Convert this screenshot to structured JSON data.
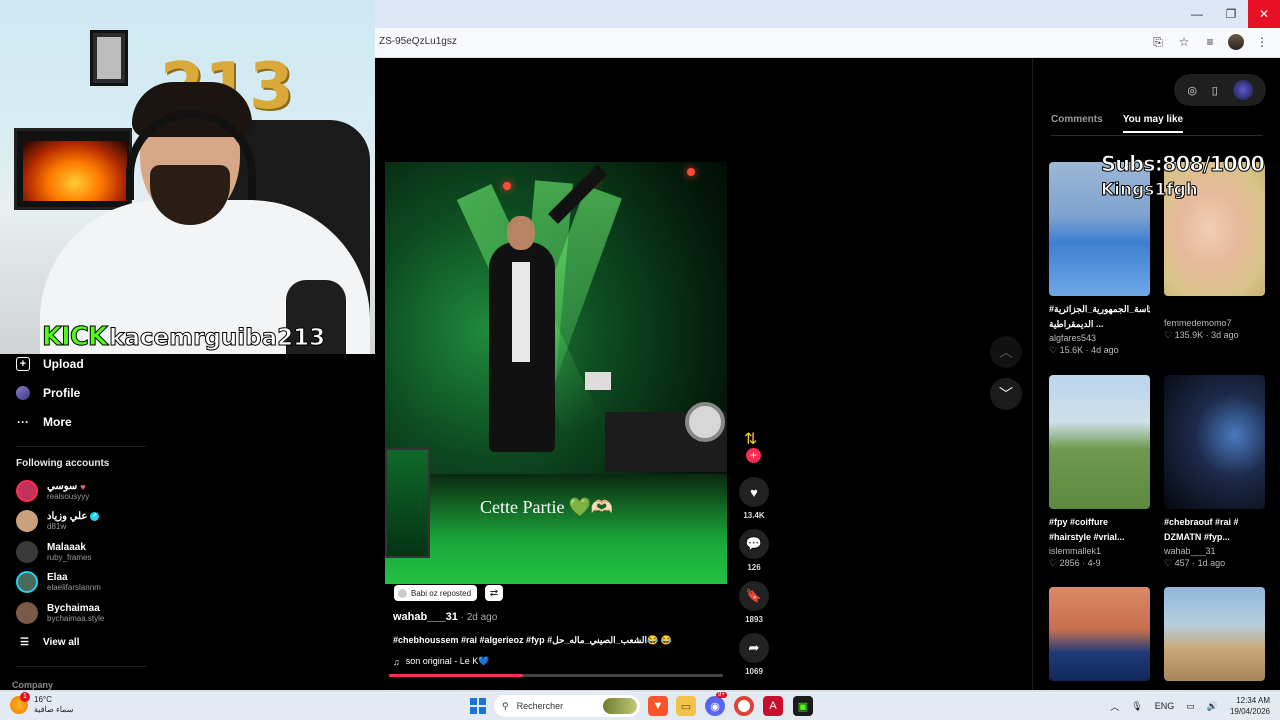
{
  "browser": {
    "url": "ZS-95eQzLu1gsz",
    "window_controls": [
      "—",
      "❐",
      "✕"
    ]
  },
  "webcam": {
    "kick_logo": "KICK",
    "streamer": "kacemrguiba213",
    "decor_number": "213"
  },
  "sidebar": {
    "nav": [
      {
        "label": "Upload",
        "icon": "upload-icon"
      },
      {
        "label": "Profile",
        "icon": "profile-icon"
      },
      {
        "label": "More",
        "icon": "more-icon"
      }
    ],
    "following_title": "Following accounts",
    "accounts": [
      {
        "name": "سوسي",
        "handle": "realsousyyy",
        "badge": "heart",
        "color": "#c2325a"
      },
      {
        "name": "علي وزياد",
        "handle": "d81w",
        "badge": "verified",
        "color": "#c9a27d"
      },
      {
        "name": "Malaaak",
        "handle": "ruby_frames",
        "badge": "",
        "color": "#3a3a3a"
      },
      {
        "name": "Elaa",
        "handle": "elaelifarslannm",
        "badge": "",
        "color": "#4a6a5a"
      },
      {
        "name": "Bychaimaa",
        "handle": "bychaimaa.style",
        "badge": "",
        "color": "#7a5a4a"
      }
    ],
    "view_all": "View all",
    "company": "Company"
  },
  "video": {
    "caption": "Cette Partie",
    "caption_emoji": "💚🫶🏻",
    "repost_label": "Babi oz reposted",
    "author": "wahab___31",
    "time": " · 2d ago",
    "description": "#chebhoussem #rai #algerieoz #fyp #الشعب_الصيني_ماله_حل😂 😂",
    "sound": "son original - Le K💙",
    "progress": 0.4
  },
  "actions": [
    {
      "name": "like",
      "icon": "♥",
      "count": "13.4K"
    },
    {
      "name": "comment",
      "icon": "💬",
      "count": "126"
    },
    {
      "name": "save",
      "icon": "🔖",
      "count": "1893"
    },
    {
      "name": "share",
      "icon": "➦",
      "count": "1069"
    }
  ],
  "right_panel": {
    "tabs": [
      "Comments",
      "You may like"
    ],
    "active_tab": "You may like",
    "subs_overlay": "Subs:808/1000",
    "subs_user": "Kings1fgh",
    "cards": [
      {
        "title": "#رئاسة_الجمهورية_الجزائرية الديمقراطية ...",
        "user": "algfares543",
        "likes": "15.6K",
        "age": "4d ago"
      },
      {
        "title": "",
        "user": "femmedemomo7",
        "likes": "135.9K",
        "age": "3d ago"
      },
      {
        "title": "#fpy #coiffure #hairstyle #vrial...",
        "user": "islemmallek1",
        "likes": "2856",
        "age": "4-9"
      },
      {
        "title": "#chebraouf #rai # DZMATN #fyp...",
        "user": "wahab___31",
        "likes": "457",
        "age": "1d ago"
      },
      {
        "title": "",
        "user": "",
        "likes": "",
        "age": ""
      },
      {
        "title": "",
        "user": "",
        "likes": "",
        "age": ""
      }
    ]
  },
  "taskbar": {
    "weather_temp": "16°C",
    "weather_desc": "سماء صافية",
    "weather_badge": "1",
    "search_placeholder": "Rechercher",
    "lang": "ENG",
    "time": "12:34 AM",
    "date": "19/04/2026",
    "discord_badge": "9+"
  }
}
